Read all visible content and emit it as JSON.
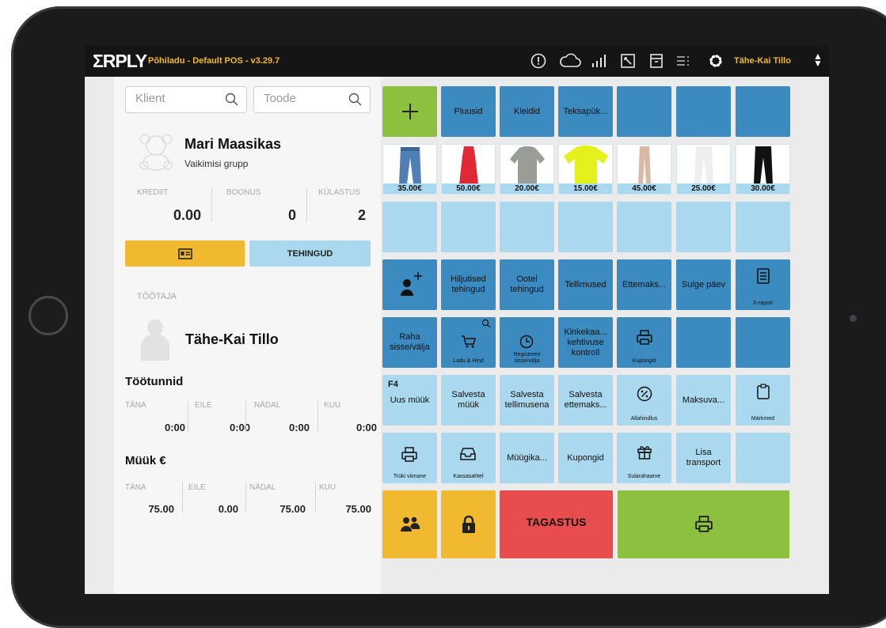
{
  "topbar": {
    "logo": "ΣRPLY",
    "version": "Põhiladu - Default POS - v3.29.7",
    "user": "Tähe-Kai Tillo",
    "icons": [
      "alert-icon",
      "cloud-icon",
      "signal-icon",
      "expand-icon",
      "archive-icon",
      "list-icon",
      "gear-icon"
    ]
  },
  "search": {
    "client_placeholder": "Klient",
    "product_placeholder": "Toode"
  },
  "customer": {
    "name": "Mari Maasikas",
    "group": "Vaikimisi grupp",
    "stats": [
      {
        "label": "KREDIIT",
        "value": "0.00"
      },
      {
        "label": "BOONUS",
        "value": "0"
      },
      {
        "label": "KÜLASTUS",
        "value": "2"
      }
    ],
    "card_button_icon": "id-card-icon",
    "transactions_label": "TEHINGUD"
  },
  "employee": {
    "section_label": "TÖÖTAJA",
    "name": "Tähe-Kai Tillo"
  },
  "work_hours": {
    "title": "Töötunnid",
    "cols": [
      {
        "label": "TÄNA",
        "value": "0:00"
      },
      {
        "label": "EILE",
        "value": "0:00"
      },
      {
        "label": "NÄDAL",
        "value": "0:00"
      },
      {
        "label": "KUU",
        "value": "0:00"
      }
    ]
  },
  "sales": {
    "title": "Müük €",
    "cols": [
      {
        "label": "TÄNA",
        "value": "75.00"
      },
      {
        "label": "EILE",
        "value": "0.00"
      },
      {
        "label": "NÄDAL",
        "value": "75.00"
      },
      {
        "label": "KUU",
        "value": "75.00"
      }
    ]
  },
  "categories": [
    "Pluusid",
    "Kleidid",
    "Teksapük..."
  ],
  "products": [
    {
      "price": "35.00€",
      "icon": "jeans-icon"
    },
    {
      "price": "50.00€",
      "icon": "dress-icon"
    },
    {
      "price": "20.00€",
      "icon": "shirt-icon"
    },
    {
      "price": "15.00€",
      "icon": "tshirt-icon"
    },
    {
      "price": "45.00€",
      "icon": "pants-icon"
    },
    {
      "price": "25.00€",
      "icon": "pants-icon"
    },
    {
      "price": "30.00€",
      "icon": "pants-icon"
    }
  ],
  "row4": {
    "add_customer_icon": "add-person-icon",
    "late": "Hiljutised tehingud",
    "pending": "Ootel tehingud",
    "orders": "Tellimused",
    "prepay": "Ettemaks...",
    "close_day": "Sulge päev",
    "xreport": "X-raport"
  },
  "row5": {
    "cash": "Raha sisse/välja",
    "stock": "Ladu & Hind",
    "clock": "Registreeri sisse/välja",
    "giftcard": "Kinkekaa... kehtivuse kontroll",
    "coupons": "Kupongid"
  },
  "row6": {
    "f4": "F4",
    "new_sale": "Uus müük",
    "save_sale": "Salvesta müük",
    "save_order": "Salvesta tellimusena",
    "save_prepay": "Salvesta ettemaks...",
    "discount": "Allahindlus",
    "payment": "Maksuva...",
    "notes": "Märkmed"
  },
  "row7": {
    "print_last": "Trüki viimane",
    "drawer": "Kassasahtel",
    "sales_person": "Müügika...",
    "coupons": "Kupongid",
    "tip": "Sularahaarve",
    "transport": "Lisa transport"
  },
  "row8": {
    "return": "TAGASTUS"
  },
  "colors": {
    "dark_tile": "#3b8ac0",
    "light_tile": "#a9d8ef",
    "green": "#8ec03f",
    "yellow": "#f0b92f",
    "red": "#e84d4d",
    "accent": "#f0b72a"
  }
}
